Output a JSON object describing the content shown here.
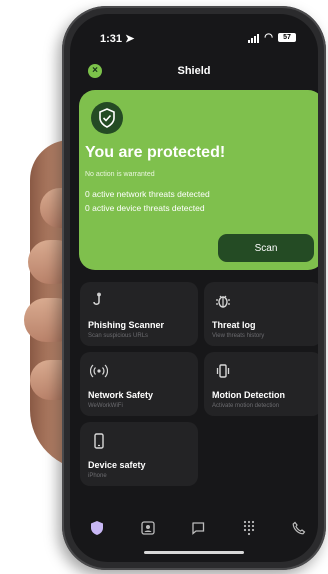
{
  "status": {
    "time": "1:31",
    "battery": "57"
  },
  "header": {
    "close_icon": "x",
    "title": "Shield"
  },
  "hero": {
    "icon": "shield-check-icon",
    "heading": "You are protected!",
    "line1": "No action is warranted",
    "line2": "0 active network threats detected",
    "line3": "0 active device threats detected",
    "scan_label": "Scan",
    "bg_color": "#7fc04d",
    "button_color": "#244b24"
  },
  "cards": [
    {
      "label": "Phishing Scanner",
      "sub": "Scan suspicious URLs",
      "icon": "hook-icon"
    },
    {
      "label": "Threat log",
      "sub": "View threats history",
      "icon": "bug-icon"
    },
    {
      "label": "Network Safety",
      "sub": "WeWorkWiFi",
      "icon": "broadcast-icon"
    },
    {
      "label": "Motion Detection",
      "sub": "Activate motion detection",
      "icon": "vibrate-icon"
    },
    {
      "label": "Device safety",
      "sub": "iPhone",
      "icon": "phone-icon"
    }
  ],
  "tabs": [
    "shield-icon",
    "contacts-icon",
    "messages-icon",
    "keypad-icon",
    "phone-call-icon"
  ],
  "accent": "#7cc24a"
}
